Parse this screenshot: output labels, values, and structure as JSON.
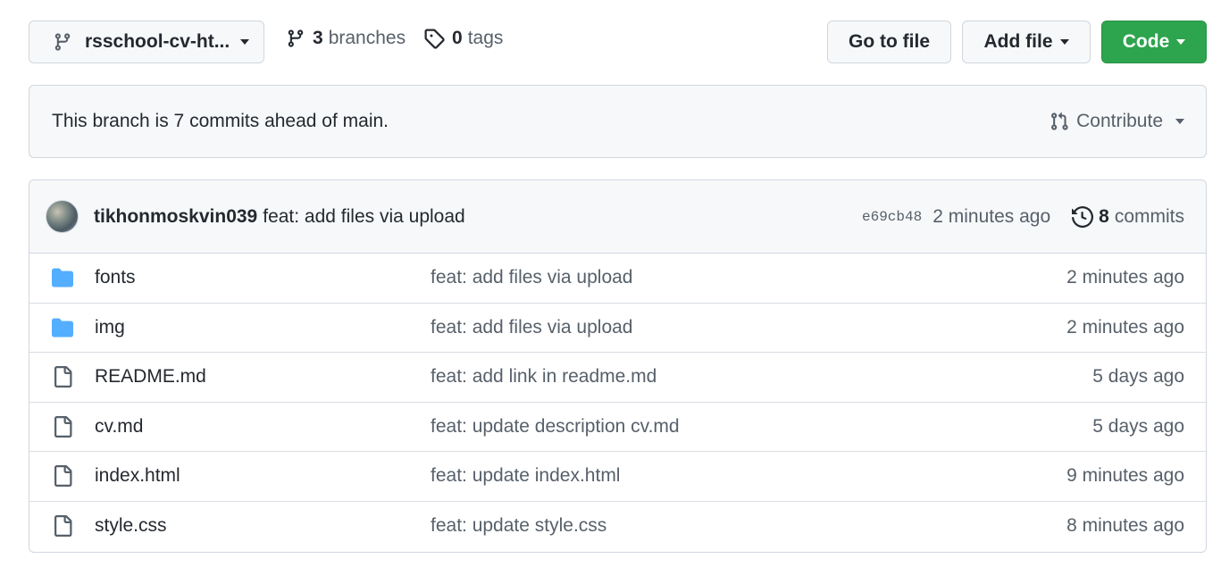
{
  "toolbar": {
    "branch_name": "rsschool-cv-ht...",
    "branches_count": "3",
    "branches_label": "branches",
    "tags_count": "0",
    "tags_label": "tags",
    "go_to_file_label": "Go to file",
    "add_file_label": "Add file",
    "code_label": "Code"
  },
  "banner": {
    "message": "This branch is 7 commits ahead of main.",
    "contribute_label": "Contribute"
  },
  "latest_commit": {
    "author": "tikhonmoskvin039",
    "message": "feat: add files via upload",
    "sha": "e69cb48",
    "time": "2 minutes ago",
    "commits_count": "8",
    "commits_label": "commits"
  },
  "files": [
    {
      "type": "folder",
      "name": "fonts",
      "commit": "feat: add files via upload",
      "age": "2 minutes ago"
    },
    {
      "type": "folder",
      "name": "img",
      "commit": "feat: add files via upload",
      "age": "2 minutes ago"
    },
    {
      "type": "file",
      "name": "README.md",
      "commit": "feat: add link in readme.md",
      "age": "5 days ago"
    },
    {
      "type": "file",
      "name": "cv.md",
      "commit": "feat: update description cv.md",
      "age": "5 days ago"
    },
    {
      "type": "file",
      "name": "index.html",
      "commit": "feat: update index.html",
      "age": "9 minutes ago"
    },
    {
      "type": "file",
      "name": "style.css",
      "commit": "feat: update style.css",
      "age": "8 minutes ago"
    }
  ],
  "colors": {
    "primary_green": "#2da44e",
    "folder_blue": "#54aeff",
    "muted_text": "#57606a",
    "border": "#d0d7de"
  }
}
